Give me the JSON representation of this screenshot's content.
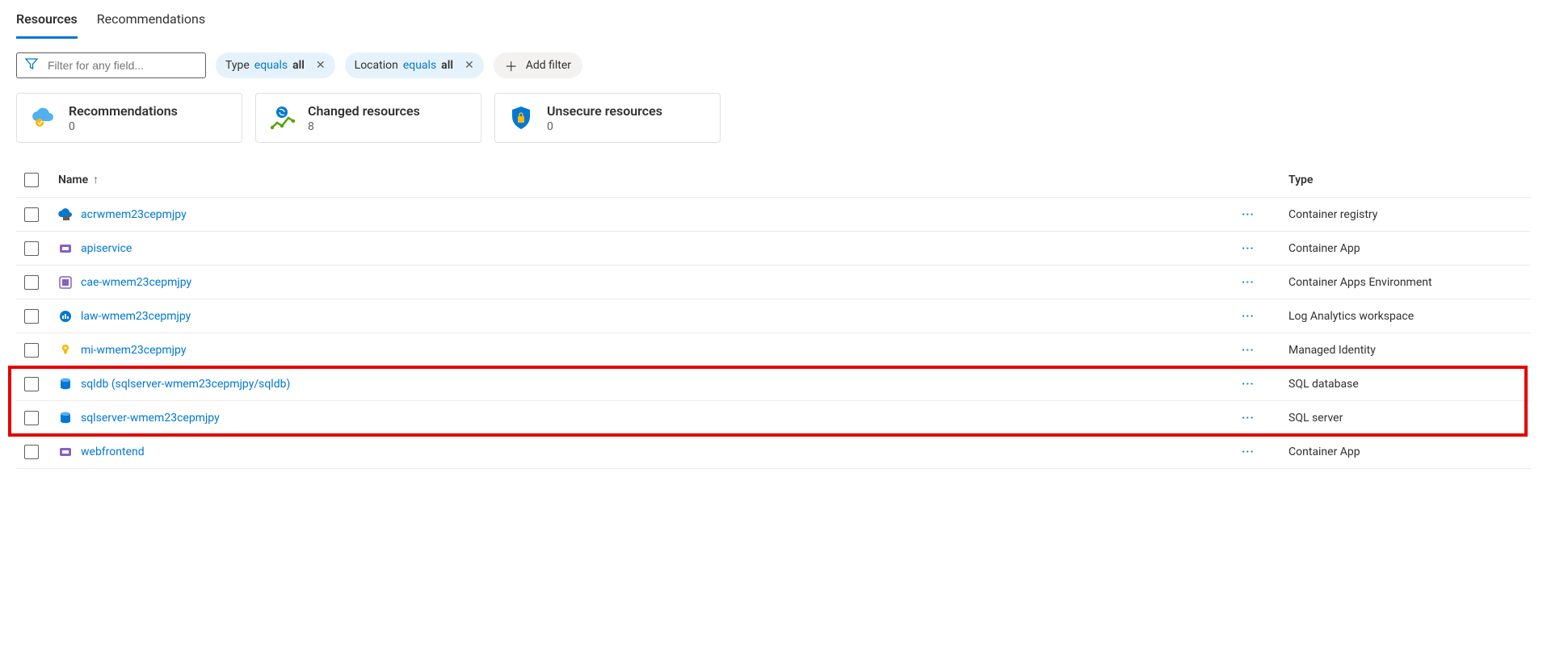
{
  "tabs": {
    "resources": "Resources",
    "recommendations": "Recommendations"
  },
  "filters": {
    "input_placeholder": "Filter for any field...",
    "type_pill": {
      "prefix": "Type",
      "verb": "equals",
      "value": "all"
    },
    "location_pill": {
      "prefix": "Location",
      "verb": "equals",
      "value": "all"
    },
    "add_filter": "Add filter"
  },
  "cards": {
    "recommendations": {
      "title": "Recommendations",
      "count": "0"
    },
    "changed": {
      "title": "Changed resources",
      "count": "8"
    },
    "unsecure": {
      "title": "Unsecure resources",
      "count": "0"
    }
  },
  "table": {
    "headers": {
      "name": "Name",
      "type": "Type"
    },
    "rows": [
      {
        "name": "acrwmem23cepmjpy",
        "type": "Container registry",
        "icon": "acr"
      },
      {
        "name": "apiservice",
        "type": "Container App",
        "icon": "capp"
      },
      {
        "name": "cae-wmem23cepmjpy",
        "type": "Container Apps Environment",
        "icon": "cae"
      },
      {
        "name": "law-wmem23cepmjpy",
        "type": "Log Analytics workspace",
        "icon": "law"
      },
      {
        "name": "mi-wmem23cepmjpy",
        "type": "Managed Identity",
        "icon": "mi"
      },
      {
        "name": "sqldb (sqlserver-wmem23cepmjpy/sqldb)",
        "type": "SQL database",
        "icon": "sql"
      },
      {
        "name": "sqlserver-wmem23cepmjpy",
        "type": "SQL server",
        "icon": "sql"
      },
      {
        "name": "webfrontend",
        "type": "Container App",
        "icon": "capp"
      }
    ]
  },
  "highlight_rows": [
    5,
    6
  ]
}
